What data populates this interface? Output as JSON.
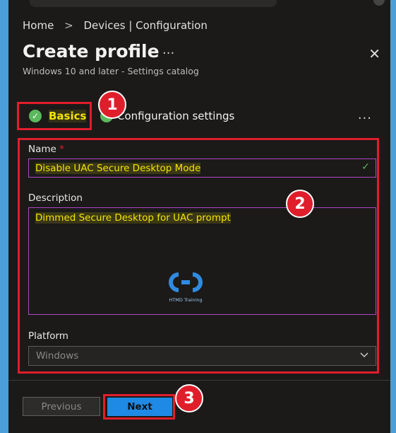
{
  "breadcrumb": {
    "home": "Home",
    "separator": ">",
    "current": "Devices | Configuration"
  },
  "header": {
    "title": "Create profile",
    "more": "...",
    "close": "✕",
    "subtitle": "Windows 10 and later - Settings catalog"
  },
  "tabs": [
    {
      "label": "Basics",
      "state": "complete",
      "active": true
    },
    {
      "label": "Configuration settings",
      "state": "complete",
      "active": false
    }
  ],
  "tabs_more": "...",
  "form": {
    "name_label": "Name",
    "required_mark": "*",
    "name_value": "Disable UAC Secure Desktop Mode",
    "description_label": "Description",
    "description_value": "Dimmed Secure Desktop for UAC prompt",
    "platform_label": "Platform",
    "platform_value": "Windows"
  },
  "watermark": {
    "text": "HTMD Training"
  },
  "annotations": [
    "1",
    "2",
    "3"
  ],
  "footer": {
    "previous_label": "Previous",
    "next_label": "Next"
  },
  "colors": {
    "accent": "#1e8ae6",
    "highlight": "#f4e400",
    "annotation": "#e01e2b",
    "success": "#5cb85c"
  }
}
